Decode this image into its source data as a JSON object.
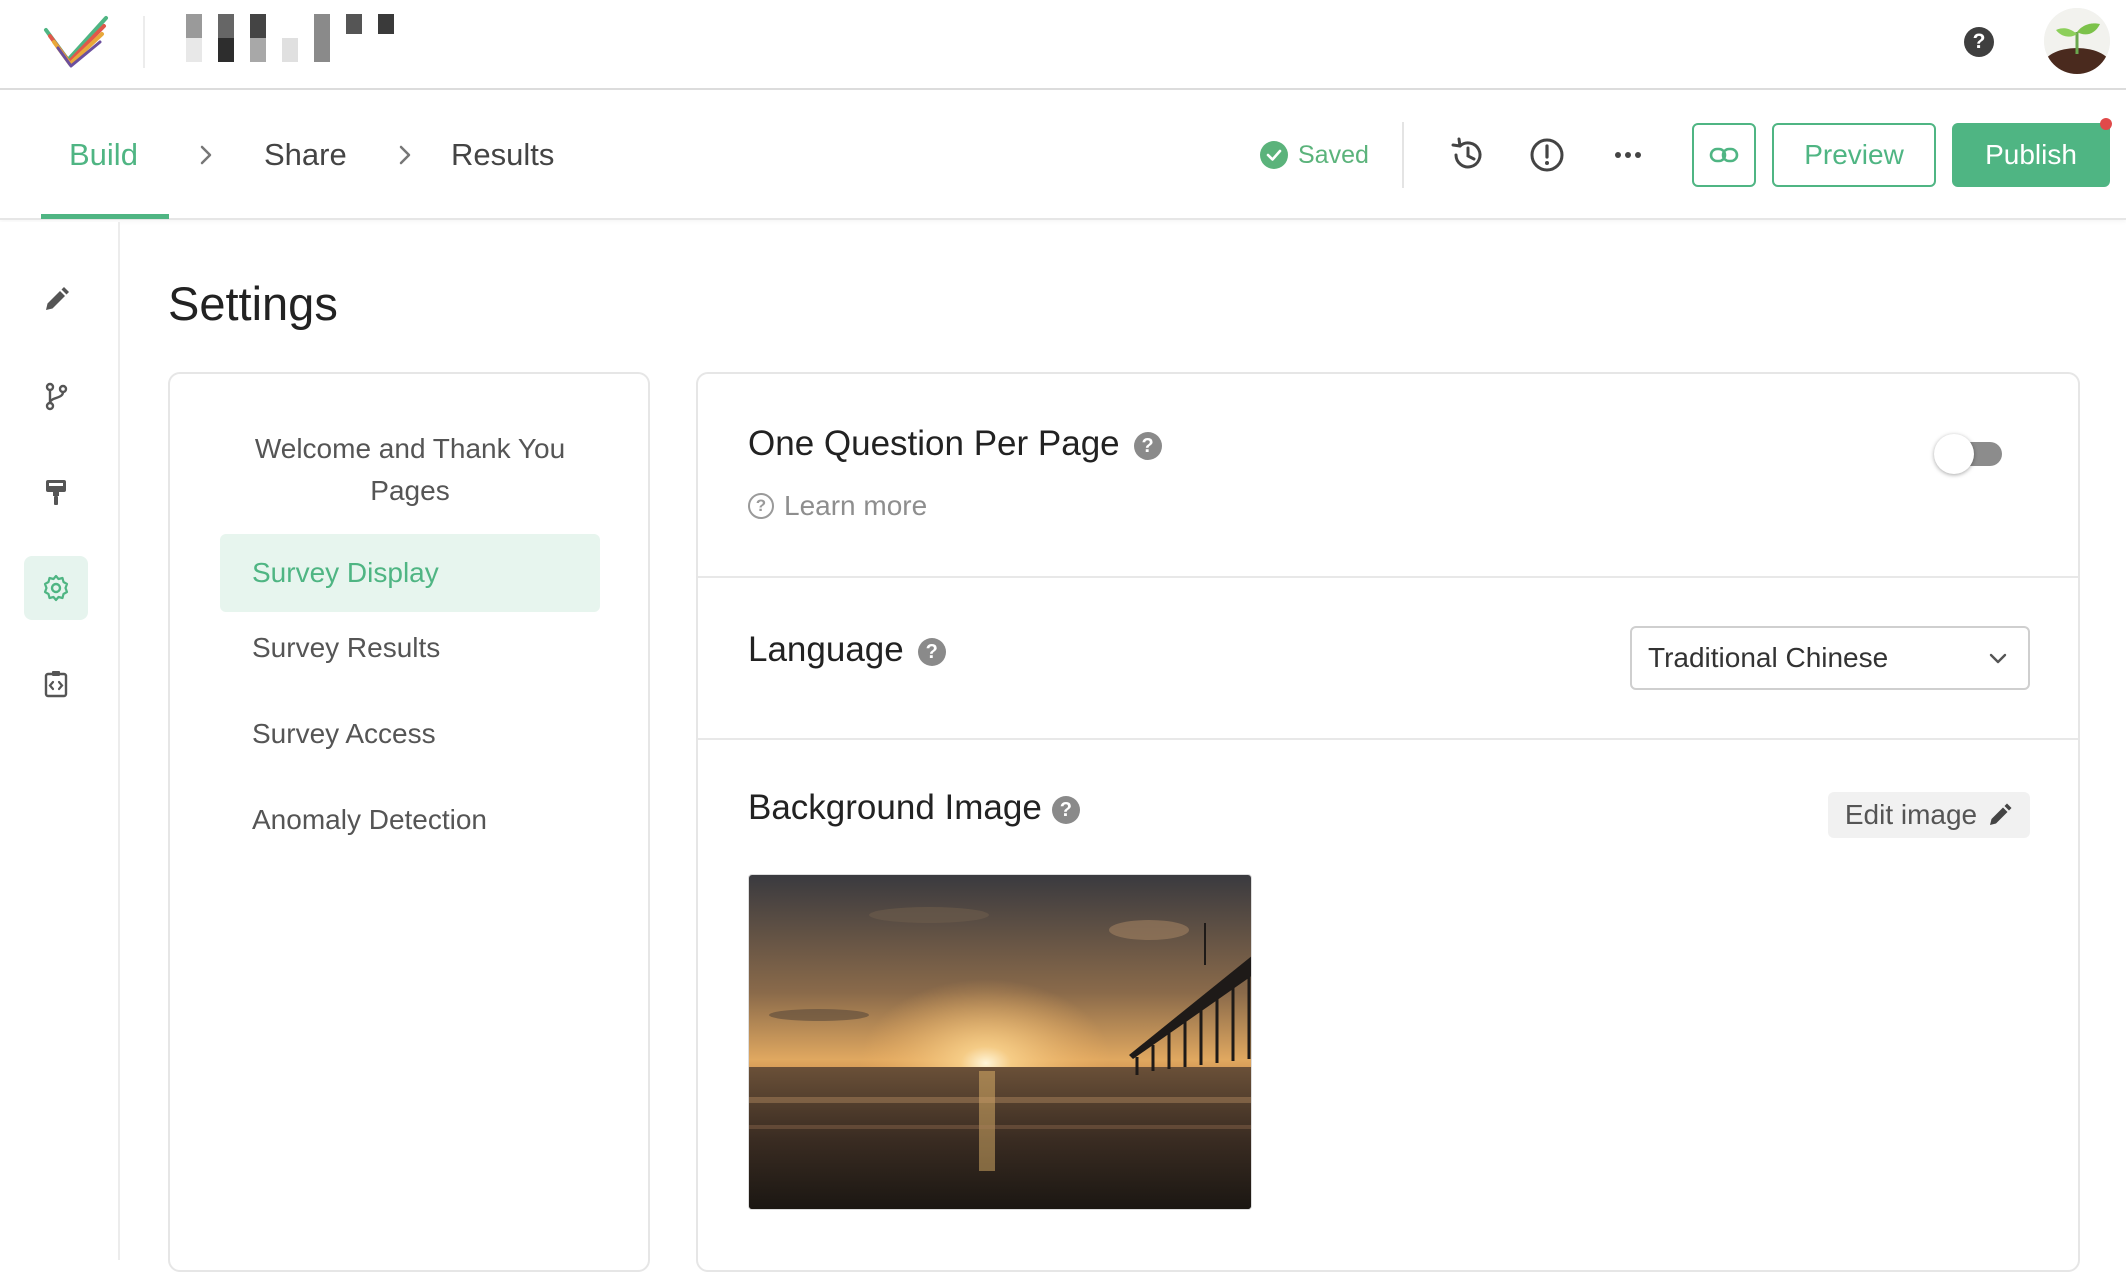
{
  "header": {
    "logo_icon": "checkmark-logo-icon",
    "help_icon": "help-icon",
    "help_glyph": "?",
    "avatar_icon": "sprout-avatar"
  },
  "nav": {
    "steps": [
      {
        "label": "Build",
        "active": true
      },
      {
        "label": "Share",
        "active": false
      },
      {
        "label": "Results",
        "active": false
      }
    ],
    "saved_label": "Saved",
    "preview_label": "Preview",
    "publish_label": "Publish",
    "accent_color": "#4fb583"
  },
  "rail": {
    "items": [
      {
        "icon": "pencil-icon",
        "active": false
      },
      {
        "icon": "branch-icon",
        "active": false
      },
      {
        "icon": "paint-roller-icon",
        "active": false
      },
      {
        "icon": "gear-icon",
        "active": true
      },
      {
        "icon": "code-clipboard-icon",
        "active": false
      }
    ]
  },
  "page": {
    "title": "Settings"
  },
  "subnav": {
    "items": [
      "Welcome and Thank You Pages",
      "Survey Display",
      "Survey Results",
      "Survey Access",
      "Anomaly Detection"
    ],
    "active_index": 1
  },
  "settings": {
    "one_question": {
      "label": "One Question Per Page",
      "help_glyph": "?",
      "learn_more": "Learn more",
      "enabled": false
    },
    "language": {
      "label": "Language",
      "help_glyph": "?",
      "selected": "Traditional Chinese"
    },
    "background": {
      "label": "Background Image",
      "help_glyph": "?",
      "edit_label": "Edit image"
    }
  }
}
